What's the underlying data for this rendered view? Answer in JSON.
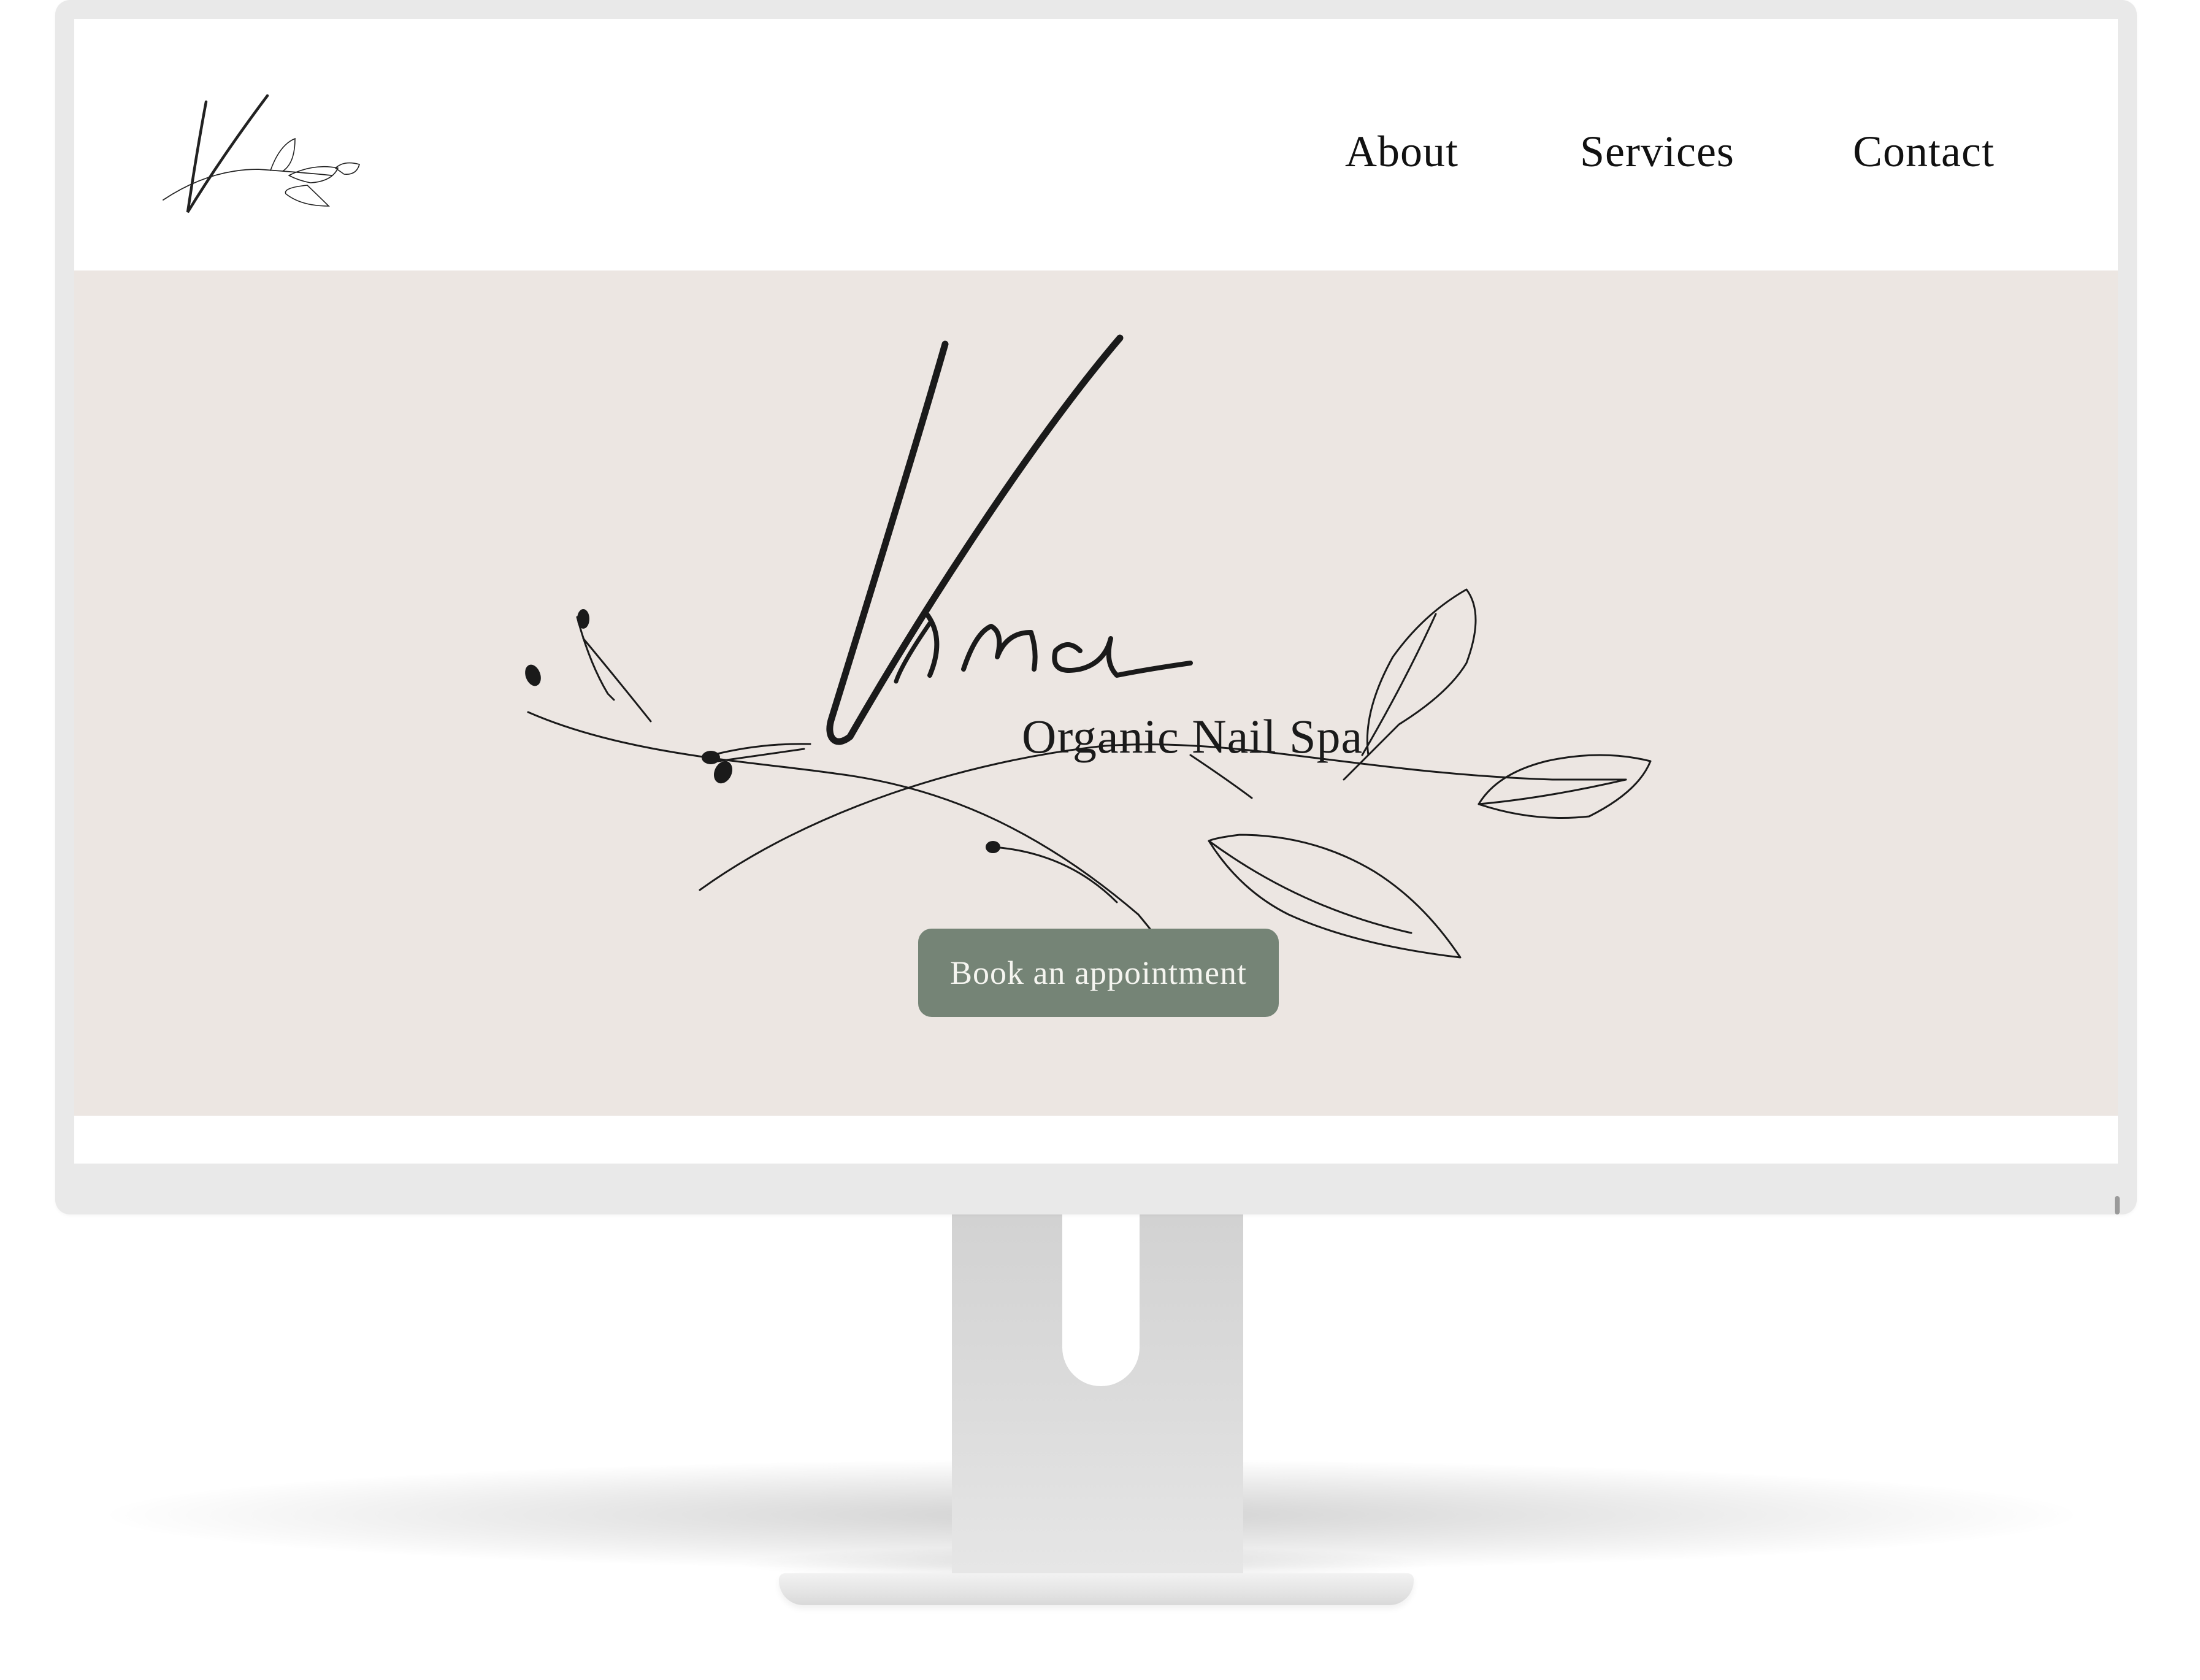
{
  "site": {
    "brand_name": "Vina",
    "tagline": "Organic Nail Spa"
  },
  "nav": {
    "items": [
      {
        "label": "About"
      },
      {
        "label": "Services"
      },
      {
        "label": "Contact"
      }
    ]
  },
  "hero": {
    "logo_script": "Vina",
    "subtitle": "Organic Nail Spa",
    "cta_label": "Book an appointment",
    "background_color": "#ece6e2",
    "cta_color": "#758476"
  },
  "icons": {
    "header_logo": "vina-monogram-logo-icon",
    "hero_decoration": "botanical-branch-icon"
  }
}
